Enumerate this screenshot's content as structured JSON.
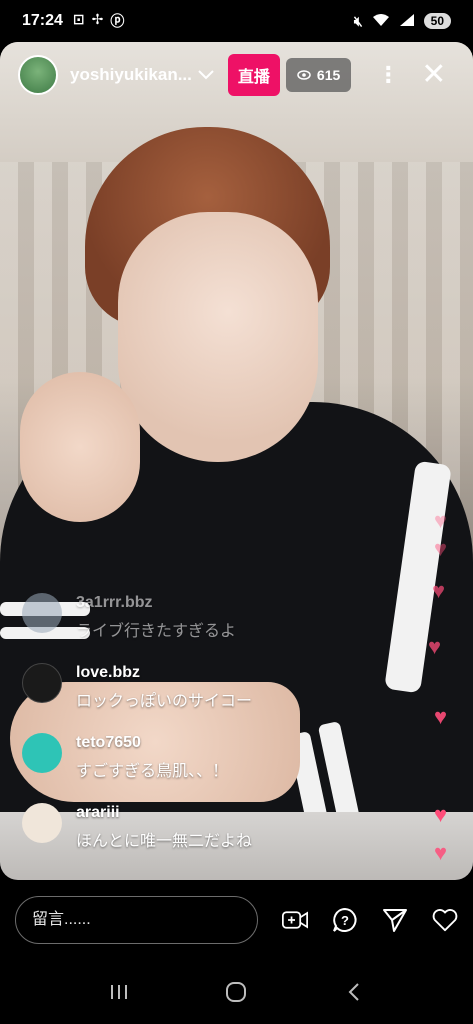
{
  "status_bar": {
    "time": "17:24",
    "battery": "50",
    "left_icons": [
      "screen-record-icon",
      "pinwheel-icon",
      "pinterest-icon"
    ],
    "right_icons": [
      "mute-icon",
      "wifi-icon",
      "signal-icon"
    ]
  },
  "live": {
    "username": "yoshiyukikan...",
    "live_label": "直播",
    "viewer_count": "615"
  },
  "comments": [
    {
      "user": "3a1rrr.bbz",
      "message": "ライブ行きたすぎるよ",
      "avatar_color": "#9aa8b8"
    },
    {
      "user": "love.bbz",
      "message": "ロックっぽいのサイコー",
      "avatar_color": "#1a1a1a"
    },
    {
      "user": "teto7650",
      "message": "すごすぎる鳥肌、、！",
      "avatar_color": "#2ec4b6"
    },
    {
      "user": "arariii",
      "message": "ほんとに唯一無二だよね",
      "avatar_color": "#f0e6da"
    }
  ],
  "bottom_bar": {
    "comment_placeholder": "留言......"
  },
  "colors": {
    "live_badge": "#ee1166",
    "heart": "#ff4d7a"
  }
}
